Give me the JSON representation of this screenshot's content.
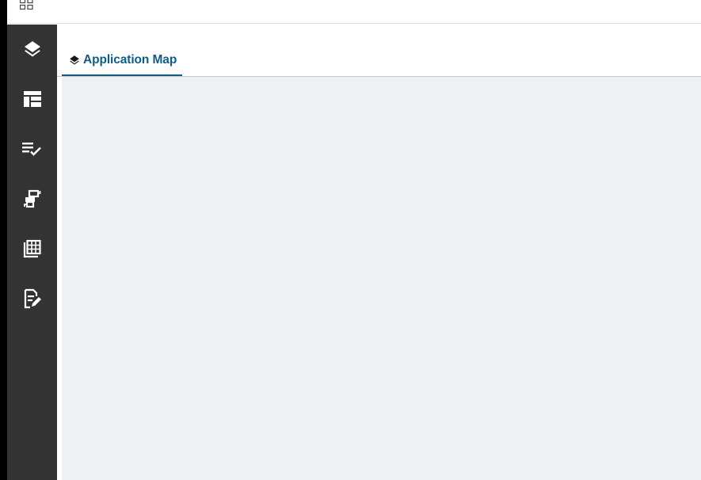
{
  "header": {
    "app_switcher_icon": "grid-icon"
  },
  "sidebar": {
    "items": [
      {
        "id": "layers",
        "icon": "layers-icon"
      },
      {
        "id": "table-layout",
        "icon": "table-layout-icon"
      },
      {
        "id": "checklist",
        "icon": "checklist-icon"
      },
      {
        "id": "flow",
        "icon": "flow-icon"
      },
      {
        "id": "grid-table",
        "icon": "grid-table-icon"
      },
      {
        "id": "edit-document",
        "icon": "edit-document-icon"
      }
    ]
  },
  "tabs": [
    {
      "label": "Application Map",
      "icon": "layers-icon",
      "active": true
    }
  ],
  "colors": {
    "sidebar_bg": "#333333",
    "accent": "#0f5d84",
    "canvas_bg": "#edf1f4"
  }
}
